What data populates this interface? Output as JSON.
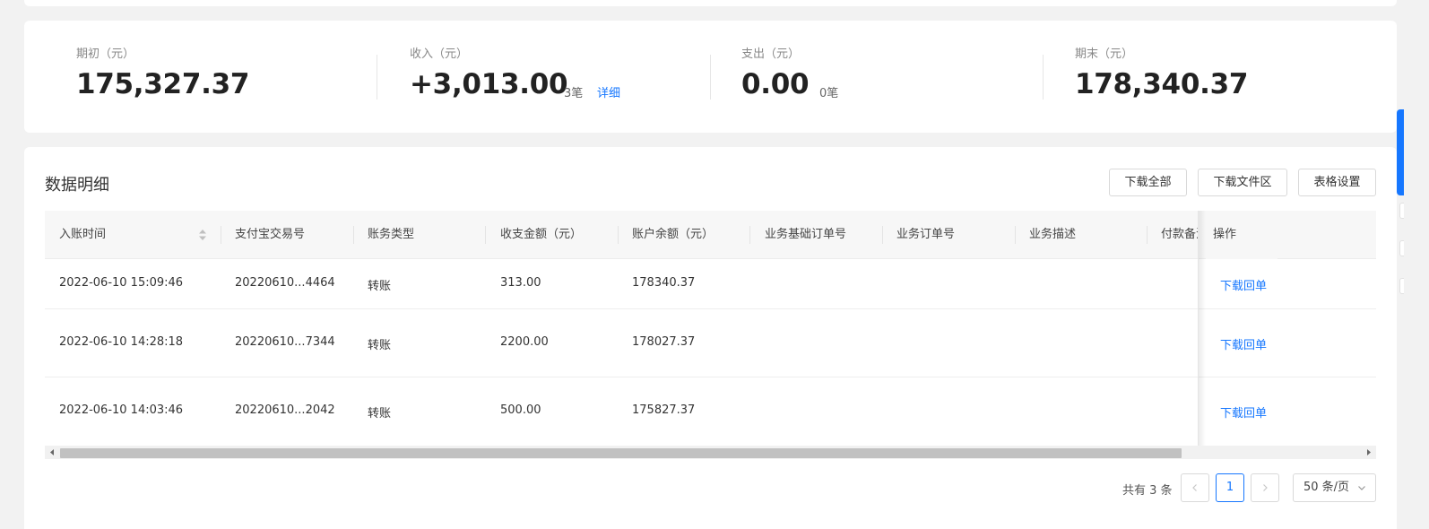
{
  "summary": {
    "opening": {
      "label": "期初（元）",
      "value": "175,327.37"
    },
    "income": {
      "label": "收入（元）",
      "value": "+3,013.00",
      "count": "3笔",
      "detail_link": "详细"
    },
    "expense": {
      "label": "支出（元）",
      "value": "0.00",
      "count": "0笔"
    },
    "closing": {
      "label": "期末（元）",
      "value": "178,340.37"
    }
  },
  "detail": {
    "title": "数据明细",
    "buttons": {
      "download_all": "下载全部",
      "download_files": "下载文件区",
      "table_settings": "表格设置"
    }
  },
  "table": {
    "columns": [
      "入账时间",
      "支付宝交易号",
      "账务类型",
      "收支金额（元）",
      "账户余额（元）",
      "业务基础订单号",
      "业务订单号",
      "业务描述",
      "付款备注",
      "操作"
    ],
    "rows": [
      {
        "time": "2022-06-10 15:09:46",
        "trade_no": "20220610...4464",
        "type": "转账",
        "amount": "313.00",
        "balance": "178340.37",
        "action": "下载回单"
      },
      {
        "time": "2022-06-10 14:28:18",
        "trade_no": "20220610...7344",
        "type": "转账",
        "amount": "2200.00",
        "balance": "178027.37",
        "action": "下载回单"
      },
      {
        "time": "2022-06-10 14:03:46",
        "trade_no": "20220610...2042",
        "type": "转账",
        "amount": "500.00",
        "balance": "175827.37",
        "action": "下载回单"
      }
    ]
  },
  "pagination": {
    "total_text": "共有 3 条",
    "current_page": "1",
    "page_size": "50 条/页"
  },
  "colors": {
    "accent": "#1677ff",
    "text": "#333333",
    "muted": "#888888",
    "background": "#f2f2f2"
  }
}
